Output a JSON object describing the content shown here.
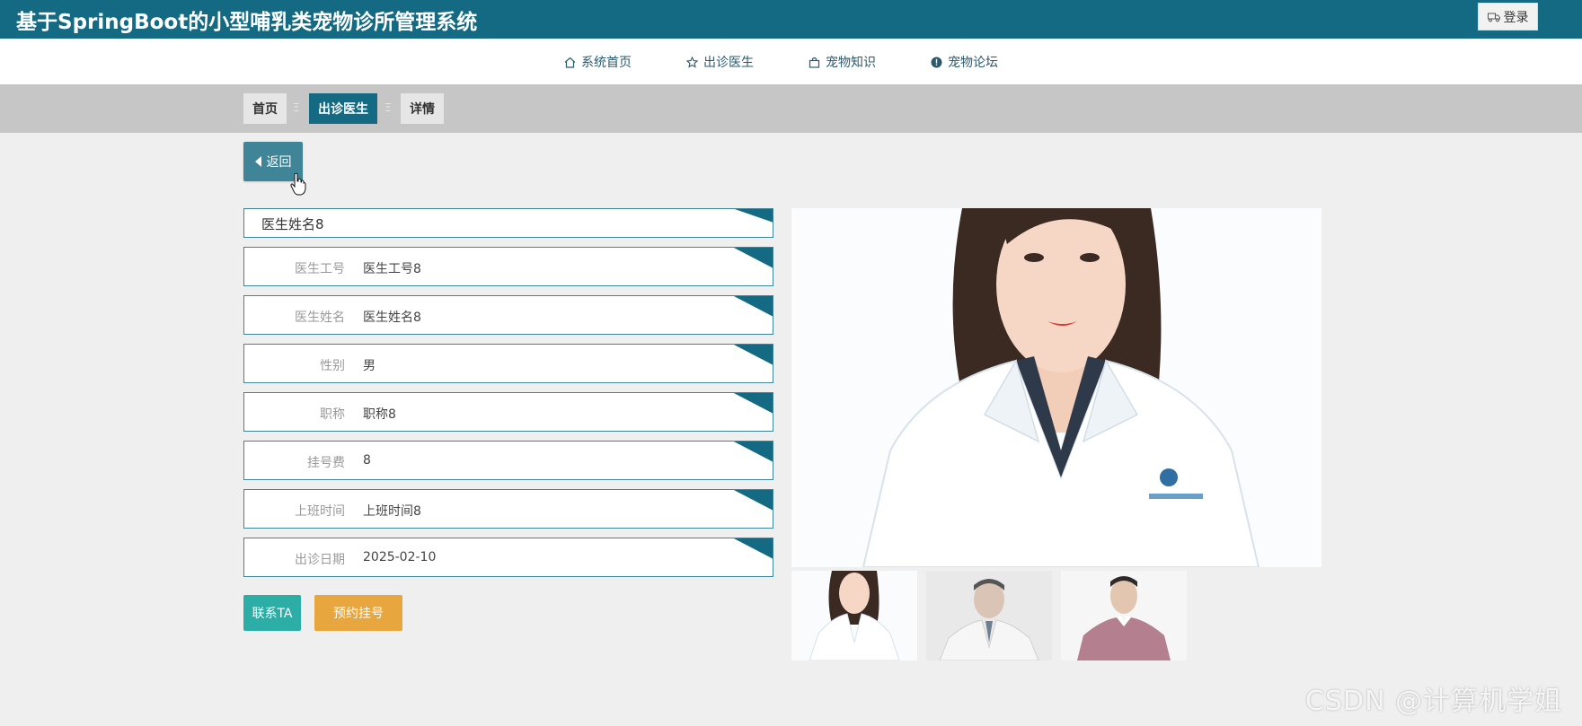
{
  "header": {
    "title": "基于SpringBoot的小型哺乳类宠物诊所管理系统",
    "login_label": "登录"
  },
  "nav": {
    "items": [
      {
        "label": "系统首页",
        "icon": "home-icon"
      },
      {
        "label": "出诊医生",
        "icon": "star-icon"
      },
      {
        "label": "宠物知识",
        "icon": "bag-icon"
      },
      {
        "label": "宠物论坛",
        "icon": "info-circle-icon"
      }
    ]
  },
  "breadcrumb": {
    "items": [
      "首页",
      "出诊医生",
      "详情"
    ],
    "separator": "Ξ"
  },
  "back_label": "返回",
  "detail": {
    "name_title": "医生姓名8",
    "fields": [
      {
        "label": "医生工号",
        "value": "医生工号8"
      },
      {
        "label": "医生姓名",
        "value": "医生姓名8"
      },
      {
        "label": "性别",
        "value": "男"
      },
      {
        "label": "职称",
        "value": "职称8"
      },
      {
        "label": "挂号费",
        "value": "8"
      },
      {
        "label": "上班时间",
        "value": "上班时间8"
      },
      {
        "label": "出诊日期",
        "value": "2025-02-10"
      }
    ]
  },
  "actions": {
    "contact_label": "联系TA",
    "book_label": "预约挂号"
  },
  "watermark": "CSDN @计算机学姐",
  "colors": {
    "primary": "#136a82",
    "back_button": "#3f8497",
    "contact_button": "#2cada6",
    "book_button": "#e8a63e",
    "page_bg": "#efefef",
    "crumb_bar": "#c6c6c6"
  }
}
